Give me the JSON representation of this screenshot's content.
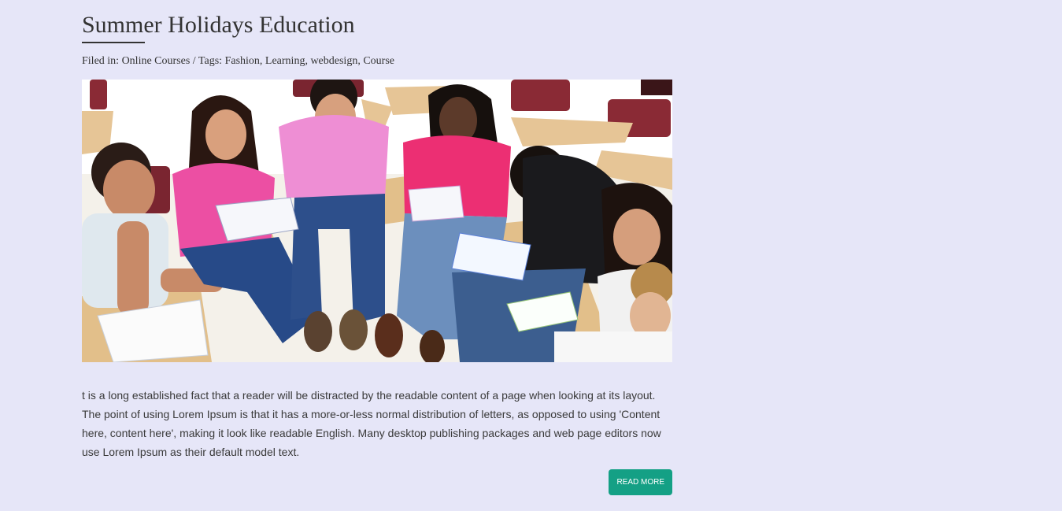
{
  "post": {
    "title": "Summer Holidays Education",
    "meta": {
      "filed_in_label": "Filed in:",
      "category": "Online Courses",
      "separator": " / ",
      "tags_label": "Tags:",
      "tags": [
        "Fashion",
        "Learning",
        "webdesign",
        "Course"
      ]
    },
    "image_alt": "Group of students studying together in a classroom",
    "excerpt": "t is a long established fact that a reader will be distracted by the readable content of a page when looking at its layout. The point of using Lorem Ipsum is that it has a more-or-less normal distribution of letters, as opposed to using 'Content here, content here', making it look like readable English. Many desktop publishing packages and web page editors now use Lorem Ipsum as their default model text.",
    "read_more_label": "READ MORE"
  },
  "colors": {
    "background": "#e6e6f8",
    "text": "#333333",
    "button": "#14a085"
  }
}
